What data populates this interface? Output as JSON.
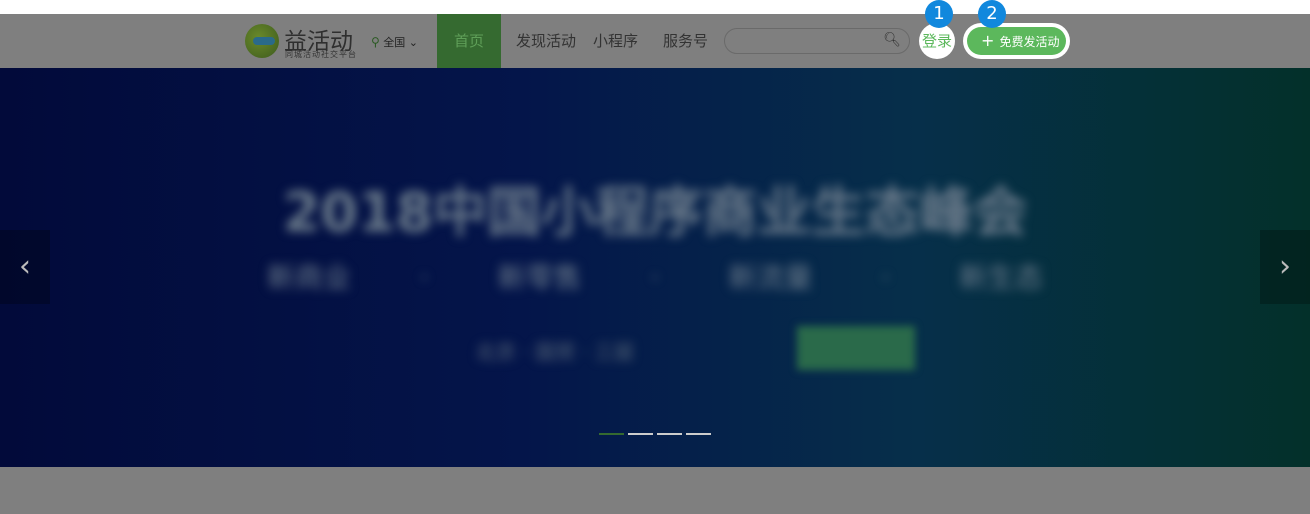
{
  "header": {
    "brand": "益活动",
    "slogan": "同城活动社交平台",
    "city": "全国",
    "nav": [
      {
        "label": "首页",
        "active": true
      },
      {
        "label": "发现活动"
      },
      {
        "label": "小程序"
      },
      {
        "label": "服务号"
      }
    ],
    "search_placeholder": "",
    "login": "登录",
    "publish": "免费发活动",
    "badges": [
      "1",
      "2"
    ]
  },
  "banner": {
    "title": "2018中国小程序商业生态峰会",
    "subtitle": "新商业 · 新零售 · 新流量 · 新生态",
    "info": "北京 · 国贸 · 三层",
    "slides": 4,
    "active_slide": 1
  },
  "colors": {
    "accent": "#5cb85c",
    "badge": "#1188dd"
  }
}
